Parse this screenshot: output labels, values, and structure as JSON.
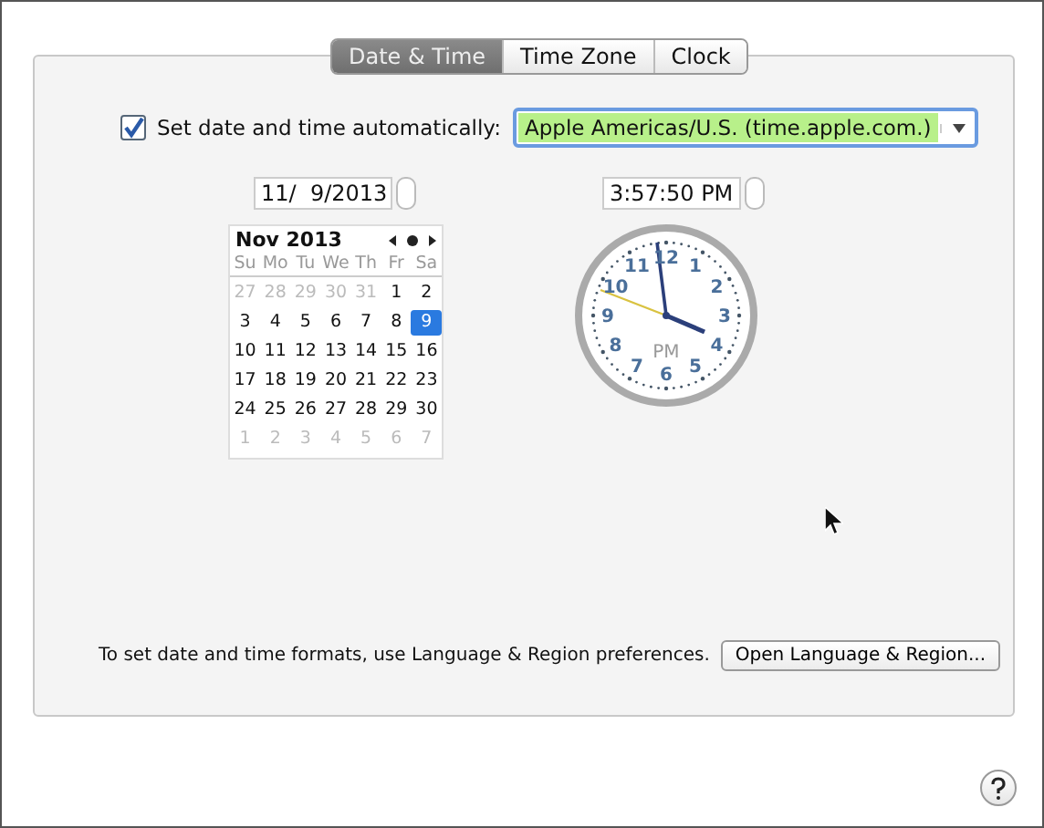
{
  "tabs": [
    {
      "label": "Date & Time",
      "selected": true
    },
    {
      "label": "Time Zone",
      "selected": false
    },
    {
      "label": "Clock",
      "selected": false
    }
  ],
  "auto_set": {
    "label": "Set date and time automatically:",
    "checked": true
  },
  "server": {
    "value": "Apple Americas/U.S. (time.apple.com.)"
  },
  "date_field": {
    "value": "11/  9/2013"
  },
  "time_field": {
    "value": "3:57:50 PM"
  },
  "calendar": {
    "month": "Nov 2013",
    "weekdays": [
      "Su",
      "Mo",
      "Tu",
      "We",
      "Th",
      "Fr",
      "Sa"
    ],
    "days": [
      {
        "label": "27",
        "other_month": true,
        "selected": false
      },
      {
        "label": "28",
        "other_month": true,
        "selected": false
      },
      {
        "label": "29",
        "other_month": true,
        "selected": false
      },
      {
        "label": "30",
        "other_month": true,
        "selected": false
      },
      {
        "label": "31",
        "other_month": true,
        "selected": false
      },
      {
        "label": "1",
        "other_month": false,
        "selected": false
      },
      {
        "label": "2",
        "other_month": false,
        "selected": false
      },
      {
        "label": "3",
        "other_month": false,
        "selected": false
      },
      {
        "label": "4",
        "other_month": false,
        "selected": false
      },
      {
        "label": "5",
        "other_month": false,
        "selected": false
      },
      {
        "label": "6",
        "other_month": false,
        "selected": false
      },
      {
        "label": "7",
        "other_month": false,
        "selected": false
      },
      {
        "label": "8",
        "other_month": false,
        "selected": false
      },
      {
        "label": "9",
        "other_month": false,
        "selected": true
      },
      {
        "label": "10",
        "other_month": false,
        "selected": false
      },
      {
        "label": "11",
        "other_month": false,
        "selected": false
      },
      {
        "label": "12",
        "other_month": false,
        "selected": false
      },
      {
        "label": "13",
        "other_month": false,
        "selected": false
      },
      {
        "label": "14",
        "other_month": false,
        "selected": false
      },
      {
        "label": "15",
        "other_month": false,
        "selected": false
      },
      {
        "label": "16",
        "other_month": false,
        "selected": false
      },
      {
        "label": "17",
        "other_month": false,
        "selected": false
      },
      {
        "label": "18",
        "other_month": false,
        "selected": false
      },
      {
        "label": "19",
        "other_month": false,
        "selected": false
      },
      {
        "label": "20",
        "other_month": false,
        "selected": false
      },
      {
        "label": "21",
        "other_month": false,
        "selected": false
      },
      {
        "label": "22",
        "other_month": false,
        "selected": false
      },
      {
        "label": "23",
        "other_month": false,
        "selected": false
      },
      {
        "label": "24",
        "other_month": false,
        "selected": false
      },
      {
        "label": "25",
        "other_month": false,
        "selected": false
      },
      {
        "label": "26",
        "other_month": false,
        "selected": false
      },
      {
        "label": "27",
        "other_month": false,
        "selected": false
      },
      {
        "label": "28",
        "other_month": false,
        "selected": false
      },
      {
        "label": "29",
        "other_month": false,
        "selected": false
      },
      {
        "label": "30",
        "other_month": false,
        "selected": false
      },
      {
        "label": "1",
        "other_month": true,
        "selected": false
      },
      {
        "label": "2",
        "other_month": true,
        "selected": false
      },
      {
        "label": "3",
        "other_month": true,
        "selected": false
      },
      {
        "label": "4",
        "other_month": true,
        "selected": false
      },
      {
        "label": "5",
        "other_month": true,
        "selected": false
      },
      {
        "label": "6",
        "other_month": true,
        "selected": false
      },
      {
        "label": "7",
        "other_month": true,
        "selected": false
      }
    ]
  },
  "clock": {
    "numerals": [
      "12",
      "11",
      "1",
      "10",
      "2",
      "9",
      "3",
      "8",
      "4",
      "7",
      "5",
      "6"
    ],
    "period": "PM"
  },
  "footer": {
    "text": "To set date and time formats, use Language & Region preferences.",
    "button": "Open Language & Region..."
  }
}
